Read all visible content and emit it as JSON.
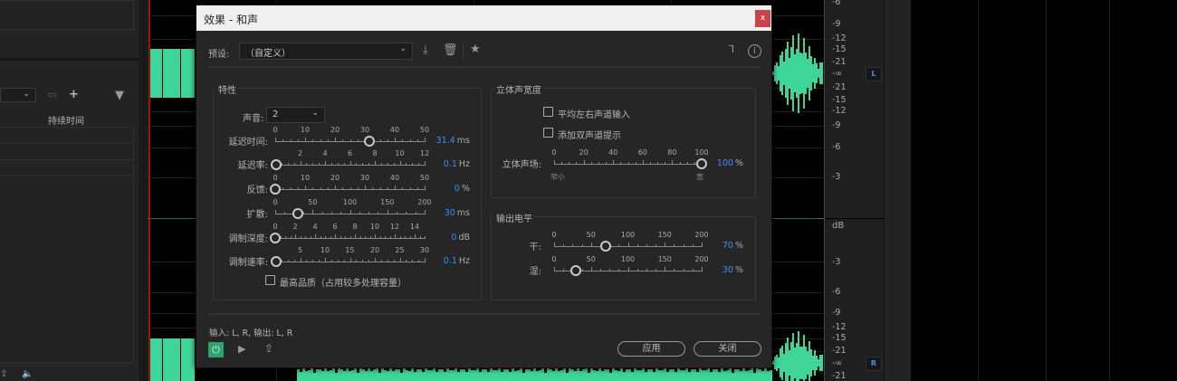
{
  "left_panel": {
    "duration_header": "持续时间"
  },
  "ruler": {
    "left_labels": [
      "-6",
      "-9",
      "-12",
      "-15",
      "-21",
      "-∞",
      "-21",
      "-15",
      "-12",
      "-9",
      "-6",
      "-3"
    ],
    "unit": "dB",
    "right_labels": [
      "-3",
      "-6",
      "-9",
      "-12",
      "-15",
      "-21",
      "-∞",
      "-21"
    ],
    "channel_left": "L",
    "channel_right": "R"
  },
  "dialog": {
    "title": "效果 - 和声",
    "close": "x",
    "preset_label": "预设:",
    "preset_value": "（自定义）",
    "characteristics": {
      "title": "特性",
      "voices_label": "声音:",
      "voices_value": "2",
      "sliders": [
        {
          "label": "延迟时间:",
          "ticks": [
            "0",
            "10",
            "20",
            "30",
            "40",
            "50"
          ],
          "tick_values": [
            0,
            10,
            20,
            30,
            40,
            50
          ],
          "min": 0,
          "max": 50,
          "value": 31.4,
          "display": "31.4",
          "unit": "ms"
        },
        {
          "label": "延迟率:",
          "ticks": [
            "2",
            "4",
            "6",
            "8",
            "10",
            "12"
          ],
          "tick_values": [
            2,
            4,
            6,
            8,
            10,
            12
          ],
          "min": 0,
          "max": 12,
          "value": 0.1,
          "display": "0.1",
          "unit": "Hz"
        },
        {
          "label": "反馈:",
          "ticks": [
            "0",
            "10",
            "20",
            "30",
            "40",
            "50"
          ],
          "tick_values": [
            0,
            10,
            20,
            30,
            40,
            50
          ],
          "min": 0,
          "max": 50,
          "value": 0,
          "display": "0",
          "unit": "%"
        },
        {
          "label": "扩散:",
          "ticks": [
            "0",
            "50",
            "100",
            "150",
            "200"
          ],
          "tick_values": [
            0,
            50,
            100,
            150,
            200
          ],
          "min": 0,
          "max": 200,
          "value": 30,
          "display": "30",
          "unit": "ms"
        },
        {
          "label": "调制深度:",
          "ticks": [
            "0",
            "2",
            "4",
            "6",
            "8",
            "10",
            "12",
            "14"
          ],
          "tick_values": [
            0,
            2,
            4,
            6,
            8,
            10,
            12,
            14
          ],
          "min": 0,
          "max": 15,
          "value": 0,
          "display": "0",
          "unit": "dB"
        },
        {
          "label": "调制速率:",
          "ticks": [
            "5",
            "10",
            "15",
            "20",
            "25",
            "30"
          ],
          "tick_values": [
            5,
            10,
            15,
            20,
            25,
            30
          ],
          "min": 0,
          "max": 30,
          "value": 0.1,
          "display": "0.1",
          "unit": "Hz"
        }
      ],
      "high_quality": "最高品质（占用较多处理容量）"
    },
    "stereo_width": {
      "title": "立体声宽度",
      "average_lr": "平均左右声道输入",
      "binaural": "添加双声道提示",
      "slider": {
        "label": "立体声场:",
        "ticks": [
          "0",
          "20",
          "40",
          "60",
          "80",
          "100"
        ],
        "tick_values": [
          0,
          20,
          40,
          60,
          80,
          100
        ],
        "min": 0,
        "max": 100,
        "value": 100,
        "display": "100",
        "unit": "%"
      },
      "narrow": "窄小",
      "wide": "宽"
    },
    "output_level": {
      "title": "输出电平",
      "sliders": [
        {
          "label": "干:",
          "ticks": [
            "0",
            "50",
            "100",
            "150",
            "200"
          ],
          "tick_values": [
            0,
            50,
            100,
            150,
            200
          ],
          "min": 0,
          "max": 200,
          "value": 70,
          "display": "70",
          "unit": "%"
        },
        {
          "label": "湿:",
          "ticks": [
            "0",
            "50",
            "100",
            "150",
            "200"
          ],
          "tick_values": [
            0,
            50,
            100,
            150,
            200
          ],
          "min": 0,
          "max": 200,
          "value": 30,
          "display": "30",
          "unit": "%"
        }
      ]
    },
    "io": "输入: L, R,  输出: L, R",
    "apply": "应用",
    "close_btn": "关闭"
  },
  "colors": {
    "accent": "#3d8ff0",
    "waveform": "#3ed598",
    "power_on": "#2fa272"
  }
}
